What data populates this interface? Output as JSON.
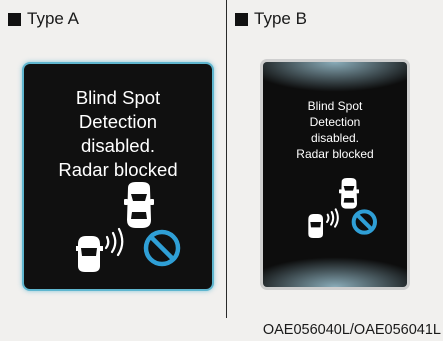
{
  "panels": {
    "a": {
      "label": "Type A",
      "message": "Blind Spot\nDetection\ndisabled.\nRadar blocked"
    },
    "b": {
      "label": "Type B",
      "message": "Blind Spot\nDetection\ndisabled.\nRadar blocked"
    }
  },
  "caption": "OAE056040L/OAE056041L",
  "icons": {
    "bullet": "black-square-icon",
    "vehicle": "car-icon",
    "radar": "radar-waves-icon",
    "blocked": "prohibited-icon"
  },
  "colors": {
    "screen": "#101010",
    "glow_a": "#5fb6cf",
    "blocked": "#2f9fd6",
    "text": "#ffffff"
  }
}
